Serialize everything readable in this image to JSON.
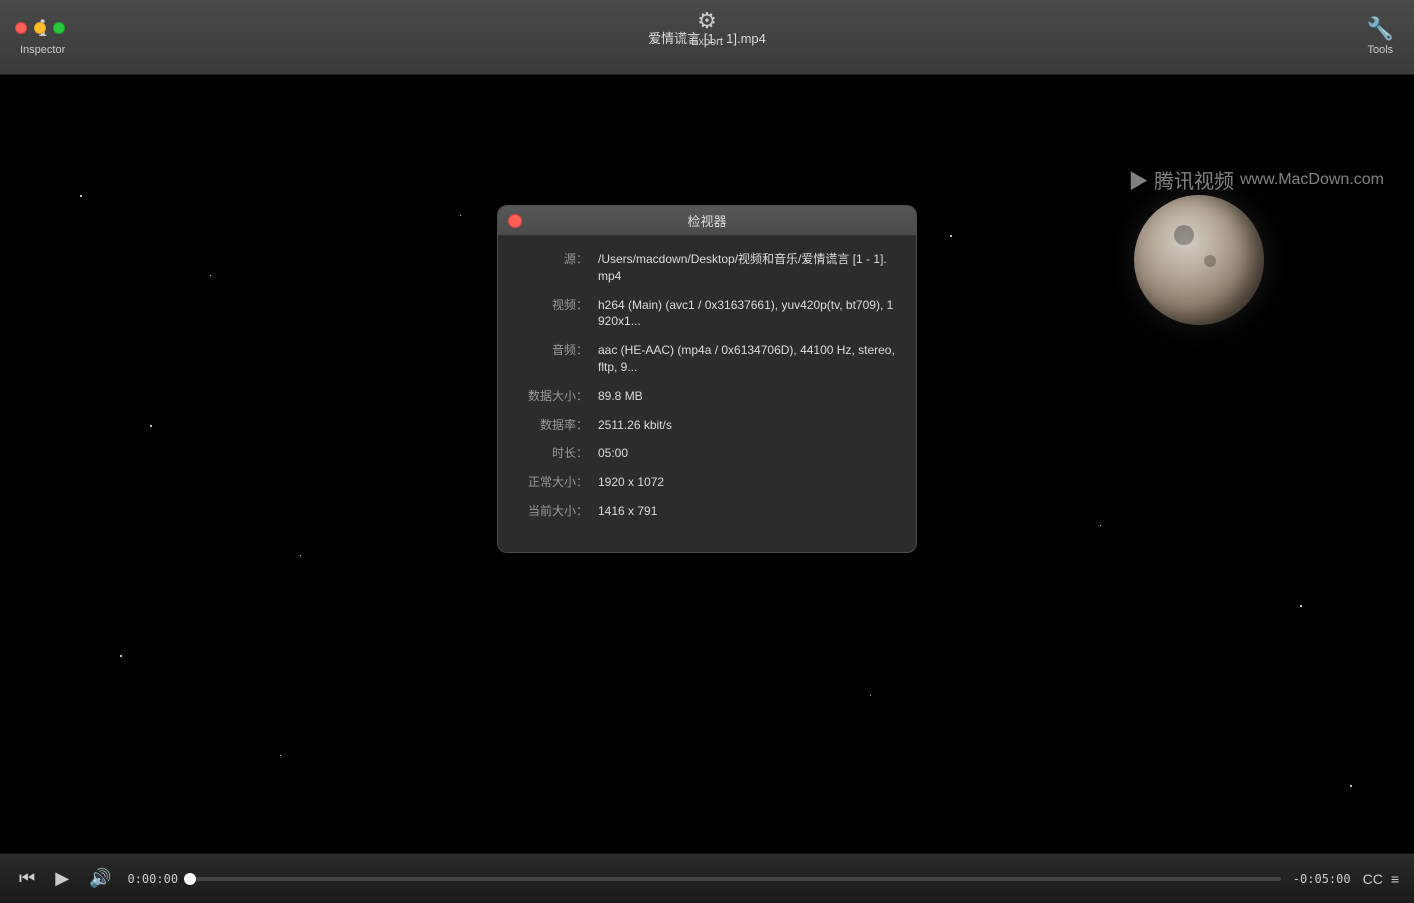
{
  "window": {
    "title": "爱情谎言 [1 - 1].mp4"
  },
  "toolbar": {
    "inspector_label": "Inspector",
    "export_label": "Export",
    "tools_label": "Tools"
  },
  "watermark": {
    "text": "www.MacDown.com"
  },
  "inspector_dialog": {
    "title": "检视器",
    "rows": [
      {
        "label": "源：",
        "value": "/Users/macdown/Desktop/视频和音乐/爱情谎言 [1 - 1].mp4"
      },
      {
        "label": "视频：",
        "value": "h264 (Main) (avc1 / 0x31637661), yuv420p(tv, bt709), 1920x1..."
      },
      {
        "label": "音频：",
        "value": "aac (HE-AAC) (mp4a / 0x6134706D), 44100 Hz, stereo, fltp, 9..."
      },
      {
        "label": "数据大小：",
        "value": "89.8 MB"
      },
      {
        "label": "数据率：",
        "value": "2511.26 kbit/s"
      },
      {
        "label": "时长：",
        "value": "05:00"
      },
      {
        "label": "正常大小：",
        "value": "1920 x 1072"
      },
      {
        "label": "当前大小：",
        "value": "1416 x 791"
      }
    ]
  },
  "controls": {
    "time_current": "0:00:00",
    "time_remaining": "-0:05:00"
  }
}
